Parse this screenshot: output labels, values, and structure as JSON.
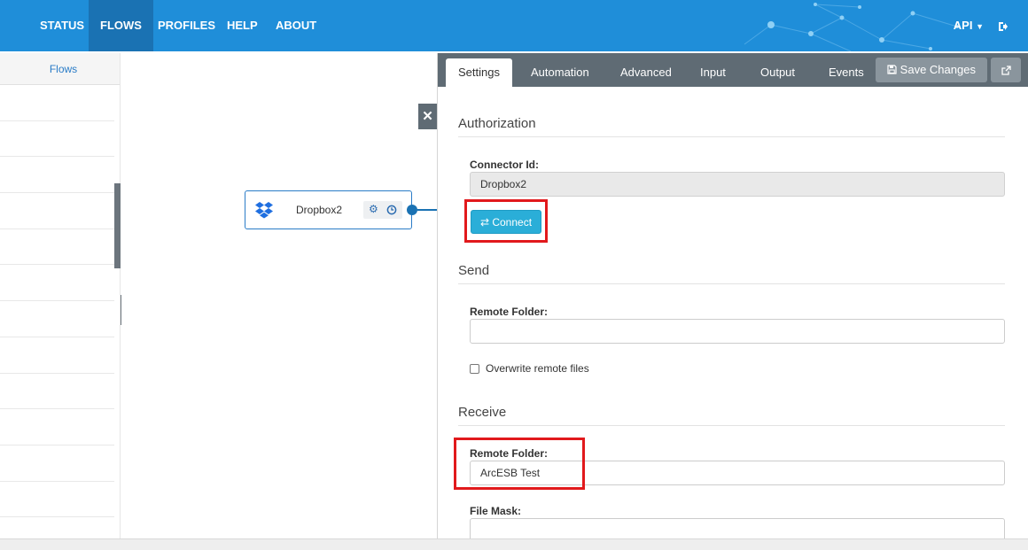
{
  "nav": {
    "items": [
      {
        "label": "STATUS",
        "active": false
      },
      {
        "label": "FLOWS",
        "active": true
      },
      {
        "label": "PROFILES",
        "active": false
      },
      {
        "label": "HELP",
        "active": false
      },
      {
        "label": "ABOUT",
        "active": false
      }
    ],
    "api_label": "API",
    "logout_icon": "sign-out-icon",
    "color": "#1f8ed9",
    "active_color": "#1a72b3"
  },
  "left_panel": {
    "header": "Flows"
  },
  "canvas": {
    "node": {
      "label": "Dropbox2",
      "icon": "dropbox-icon",
      "actions": [
        "gear-icon",
        "clock-icon"
      ]
    }
  },
  "settings": {
    "tabs": [
      "Settings",
      "Automation",
      "Advanced",
      "Input",
      "Output",
      "Events"
    ],
    "active_tab": "Settings",
    "save_label": "Save Changes",
    "popout_icon": "external-link-icon",
    "authorization": {
      "title": "Authorization",
      "connector_id_label": "Connector Id:",
      "connector_id_value": "Dropbox2",
      "connect_label": "Connect"
    },
    "send": {
      "title": "Send",
      "remote_folder_label": "Remote Folder:",
      "remote_folder_value": "",
      "overwrite_label": "Overwrite remote files",
      "overwrite_checked": false
    },
    "receive": {
      "title": "Receive",
      "remote_folder_label": "Remote Folder:",
      "remote_folder_value": "ArcESB Test",
      "file_mask_label": "File Mask:",
      "file_mask_value": ""
    }
  },
  "highlight_color": "#e1191c",
  "connect_color": "#2aaed8"
}
